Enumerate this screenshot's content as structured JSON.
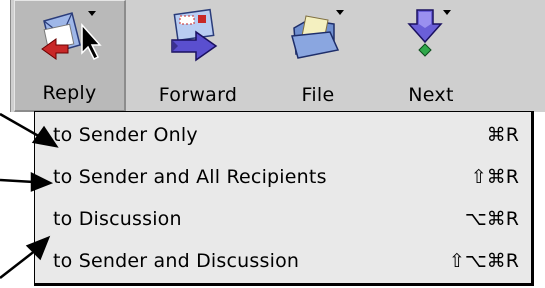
{
  "toolbar": {
    "buttons": [
      {
        "label": "Reply",
        "icon": "reply-icon"
      },
      {
        "label": "Forward",
        "icon": "forward-icon"
      },
      {
        "label": "File",
        "icon": "file-icon"
      },
      {
        "label": "Next",
        "icon": "next-icon"
      }
    ]
  },
  "menu": {
    "items": [
      {
        "label": "to Sender Only",
        "shortcut": "⌘R"
      },
      {
        "label": "to Sender and All Recipients",
        "shortcut": "⇧⌘R"
      },
      {
        "label": "to Discussion",
        "shortcut": "⌥⌘R"
      },
      {
        "label": "to Sender and Discussion",
        "shortcut": "⇧⌥⌘R"
      }
    ]
  },
  "colors": {
    "toolbar_bg": "#cfcfcf",
    "menu_bg": "#e9e9e9",
    "envelope_blue": "#9fb7e8",
    "arrow_purple": "#5a4fcf",
    "folder_yellow": "#d9c55a"
  }
}
